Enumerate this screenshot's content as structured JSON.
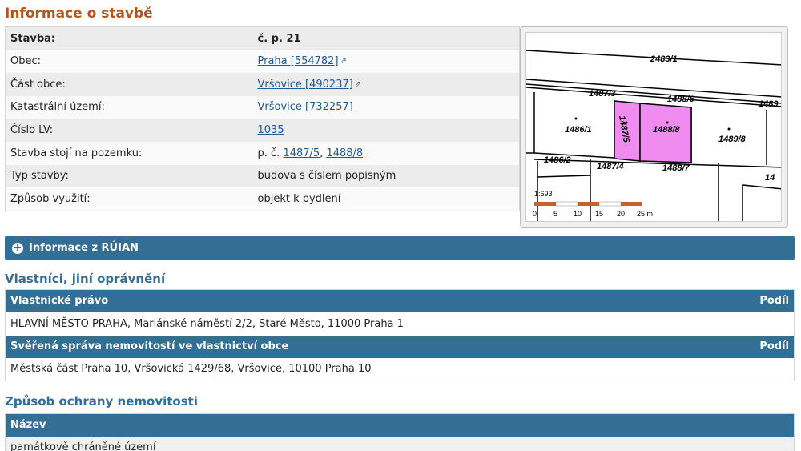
{
  "page_title": "Informace o stavbě",
  "building": {
    "rows": [
      {
        "label": "Stavba:",
        "value": "č. p. 21"
      },
      {
        "label": "Obec:",
        "value": "Praha [554782]"
      },
      {
        "label": "Část obce:",
        "value": "Vršovice [490237]"
      },
      {
        "label": "Katastrální území:",
        "value": "Vršovice [732257]"
      },
      {
        "label": "Číslo LV:",
        "value": "1035"
      },
      {
        "label": "Stavba stojí na pozemku:",
        "prefix": "p. č.",
        "link1": "1487/5",
        "sep": ",",
        "link2": "1488/8"
      },
      {
        "label": "Typ stavby:",
        "value": "budova s číslem popisným"
      },
      {
        "label": "Způsob využití:",
        "value": "objekt k bydlení"
      }
    ]
  },
  "map": {
    "parcels": [
      "2483/1",
      "1487/3",
      "1488/6",
      "1489",
      "1486/1",
      "1487/5",
      "1488/8",
      "1489/8",
      "1486/2",
      "1487/4",
      "1488/7",
      "14"
    ],
    "scale_text": "1:693",
    "scale_ticks": [
      "0",
      "5",
      "10",
      "15",
      "20",
      "25 m"
    ],
    "highlight_color": "#f08cf0"
  },
  "ruian": {
    "label": "Informace z RÚIAN"
  },
  "owners_section": {
    "title": "Vlastníci, jiní oprávnění",
    "group1": {
      "header": "Vlastnické právo",
      "share": "Podíl",
      "row": "HLAVNÍ MĚSTO PRAHA, Mariánské náměstí 2/2, Staré Město, 11000 Praha 1"
    },
    "group2": {
      "header": "Svěřená správa nemovitostí ve vlastnictví obce",
      "share": "Podíl",
      "row": "Městská část Praha 10, Vršovická 1429/68, Vršovice, 10100 Praha 10"
    }
  },
  "protection_section": {
    "title": "Způsob ochrany nemovitosti",
    "header": "Název",
    "row": "památkově chráněné území"
  }
}
